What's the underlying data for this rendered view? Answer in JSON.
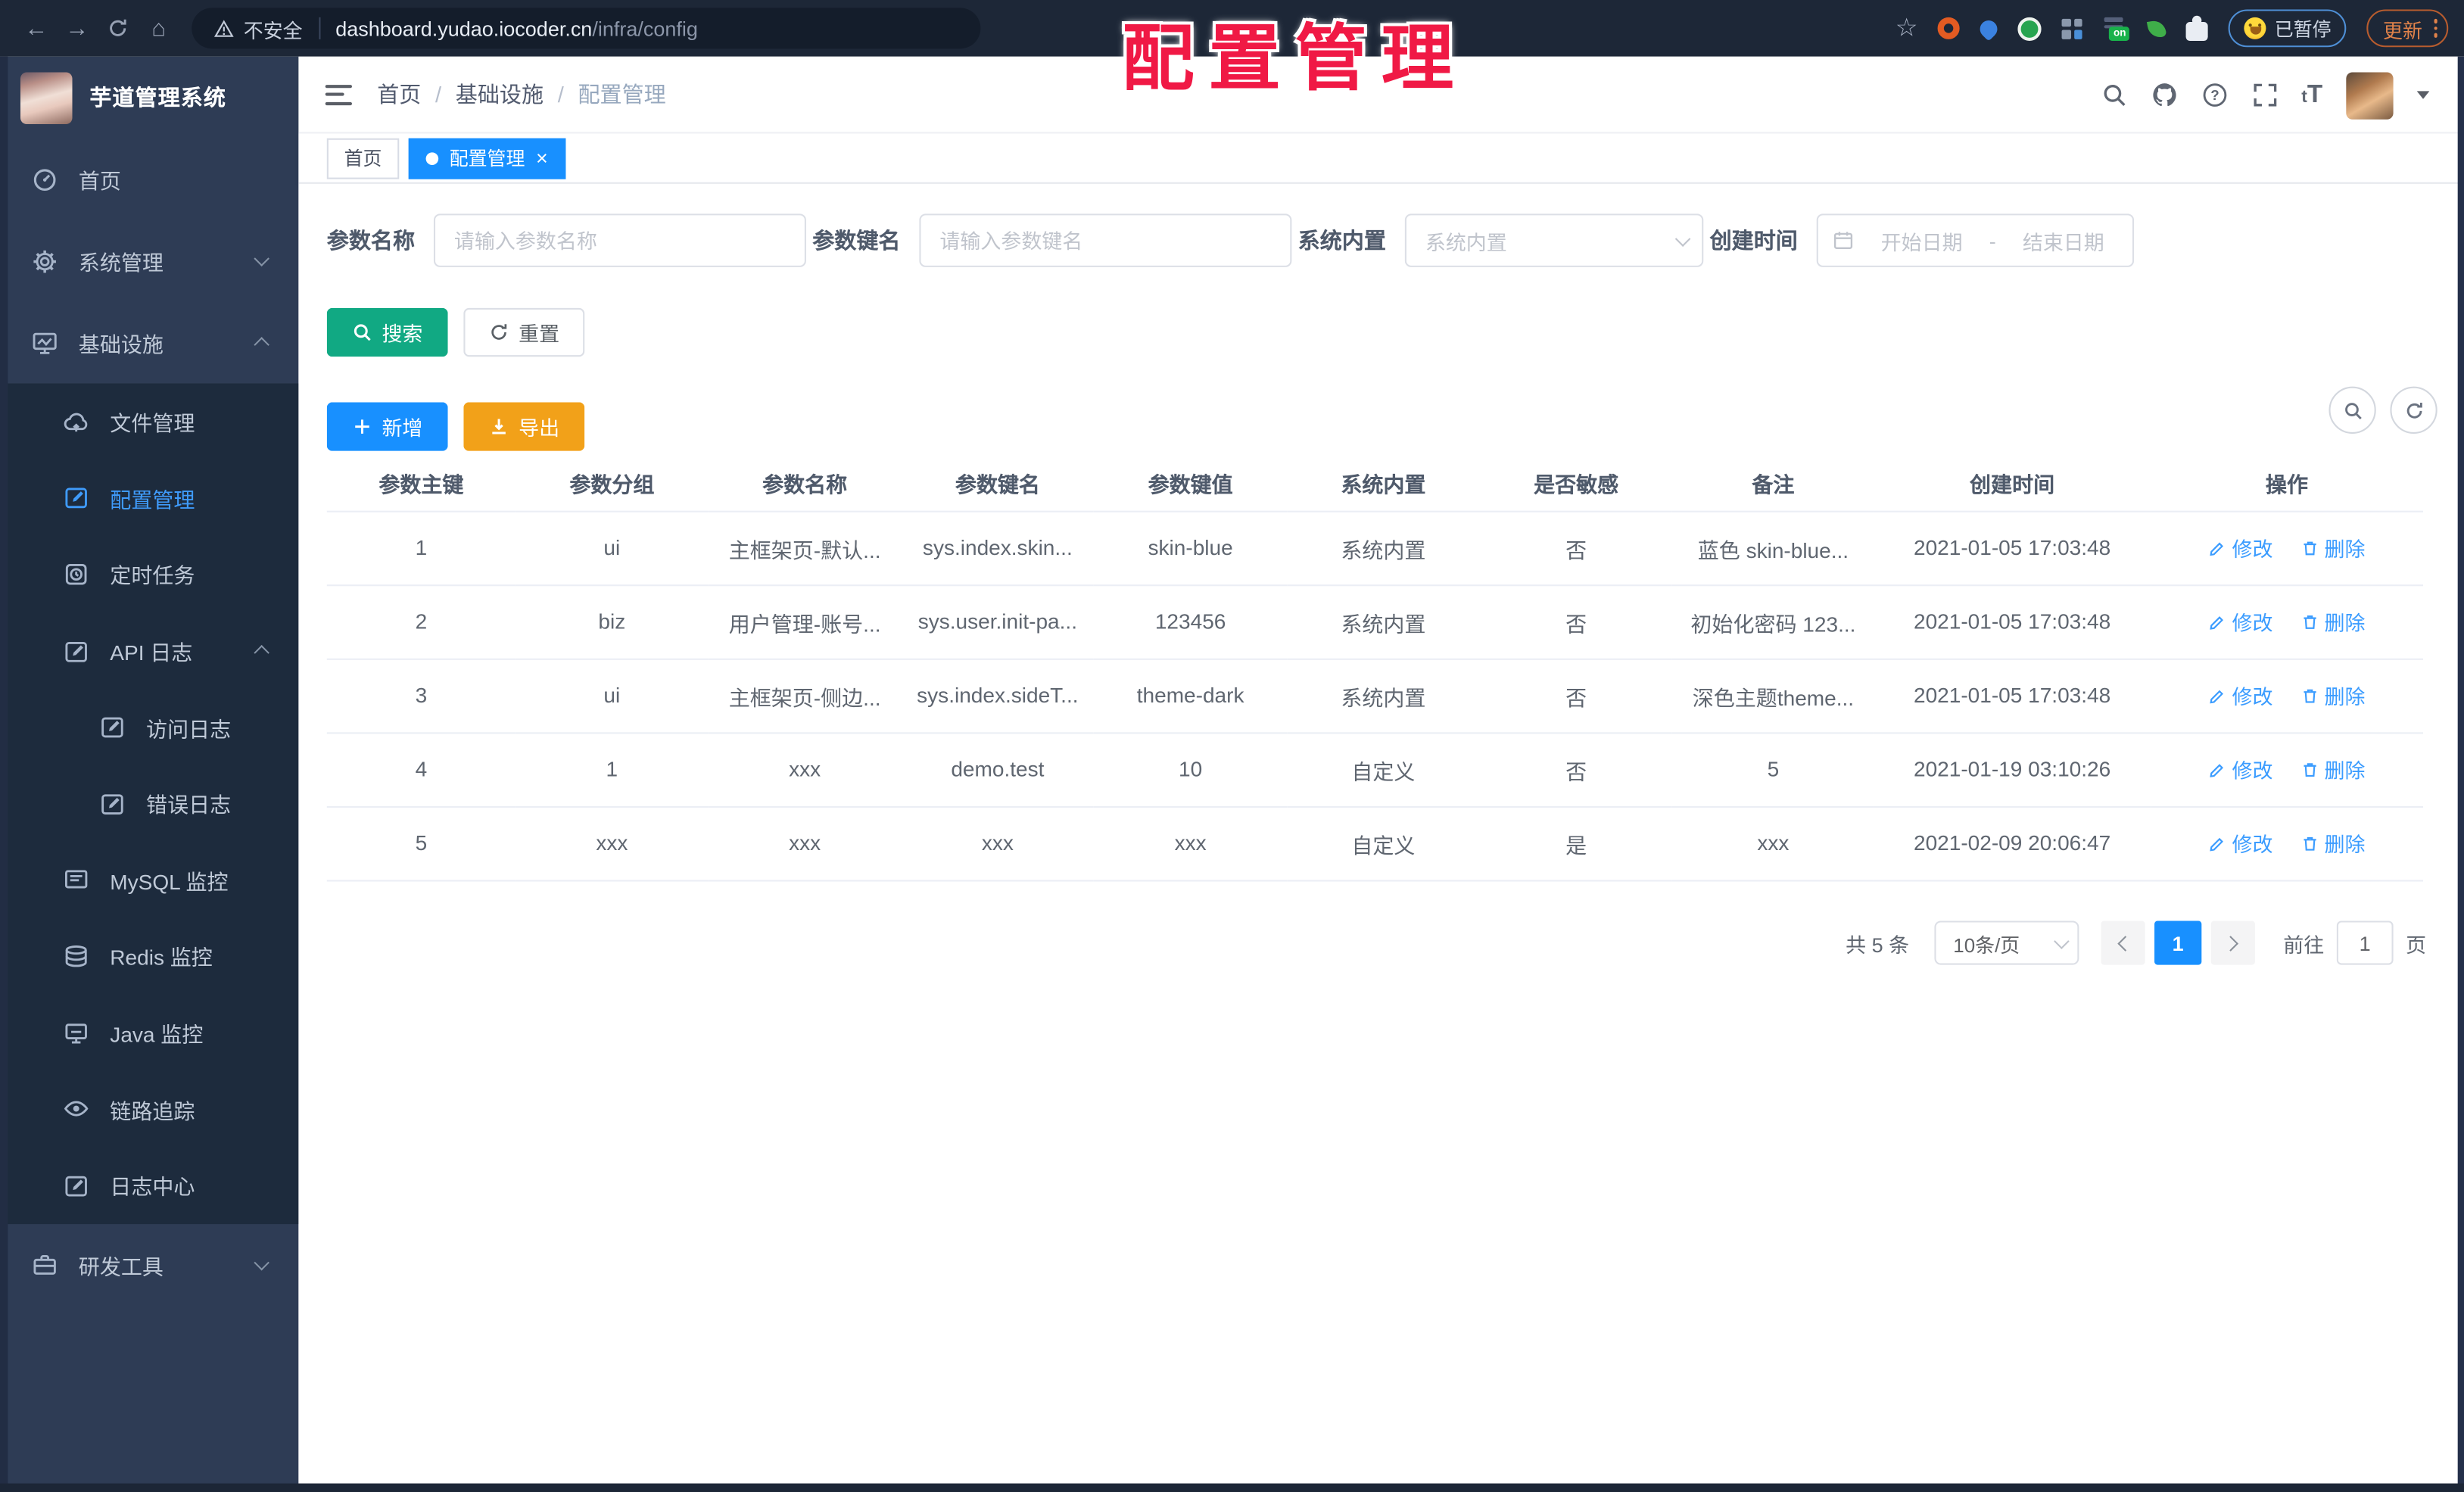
{
  "browser": {
    "security_label": "不安全",
    "url_host": "dashboard.yudao.iocoder.cn",
    "url_path": "/infra/config",
    "paused_badge": "已暂停",
    "update_button": "更新"
  },
  "watermark": "配置管理",
  "sidebar": {
    "title": "芋道管理系统",
    "items": [
      {
        "label": "首页"
      },
      {
        "label": "系统管理"
      },
      {
        "label": "基础设施"
      },
      {
        "label": "文件管理"
      },
      {
        "label": "配置管理"
      },
      {
        "label": "定时任务"
      },
      {
        "label": "API 日志"
      },
      {
        "label": "访问日志"
      },
      {
        "label": "错误日志"
      },
      {
        "label": "MySQL 监控"
      },
      {
        "label": "Redis 监控"
      },
      {
        "label": "Java 监控"
      },
      {
        "label": "链路追踪"
      },
      {
        "label": "日志中心"
      },
      {
        "label": "研发工具"
      }
    ]
  },
  "header": {
    "breadcrumbs": [
      "首页",
      "基础设施",
      "配置管理"
    ]
  },
  "tabs": [
    {
      "label": "首页"
    },
    {
      "label": "配置管理"
    }
  ],
  "filters": {
    "name_label": "参数名称",
    "name_placeholder": "请输入参数名称",
    "key_label": "参数键名",
    "key_placeholder": "请输入参数键名",
    "builtin_label": "系统内置",
    "builtin_placeholder": "系统内置",
    "date_label": "创建时间",
    "date_start": "开始日期",
    "date_sep": "-",
    "date_end": "结束日期"
  },
  "buttons": {
    "search": "搜索",
    "reset": "重置",
    "add": "新增",
    "export": "导出"
  },
  "table": {
    "columns": [
      "参数主键",
      "参数分组",
      "参数名称",
      "参数键名",
      "参数键值",
      "系统内置",
      "是否敏感",
      "备注",
      "创建时间",
      "操作"
    ],
    "actions": {
      "edit": "修改",
      "delete": "删除"
    },
    "rows": [
      {
        "cells": [
          "1",
          "ui",
          "主框架页-默认...",
          "sys.index.skin...",
          "skin-blue",
          "系统内置",
          "否",
          "蓝色 skin-blue...",
          "2021-01-05 17:03:48"
        ]
      },
      {
        "cells": [
          "2",
          "biz",
          "用户管理-账号...",
          "sys.user.init-pa...",
          "123456",
          "系统内置",
          "否",
          "初始化密码 123...",
          "2021-01-05 17:03:48"
        ]
      },
      {
        "cells": [
          "3",
          "ui",
          "主框架页-侧边...",
          "sys.index.sideT...",
          "theme-dark",
          "系统内置",
          "否",
          "深色主题theme...",
          "2021-01-05 17:03:48"
        ]
      },
      {
        "cells": [
          "4",
          "1",
          "xxx",
          "demo.test",
          "10",
          "自定义",
          "否",
          "5",
          "2021-01-19 03:10:26"
        ]
      },
      {
        "cells": [
          "5",
          "xxx",
          "xxx",
          "xxx",
          "xxx",
          "自定义",
          "是",
          "xxx",
          "2021-02-09 20:06:47"
        ]
      }
    ]
  },
  "pagination": {
    "total": "共 5 条",
    "page_size": "10条/页",
    "current_page": "1",
    "goto_prefix": "前往",
    "goto_value": "1",
    "goto_suffix": "页"
  },
  "colors": {
    "primary": "#1890ff",
    "search_button": "#11a983",
    "export_button": "#f2a119",
    "watermark_red": "#f01945",
    "sidebar_bg": "#2e3c55",
    "submenu_bg": "#1d2b3d"
  }
}
